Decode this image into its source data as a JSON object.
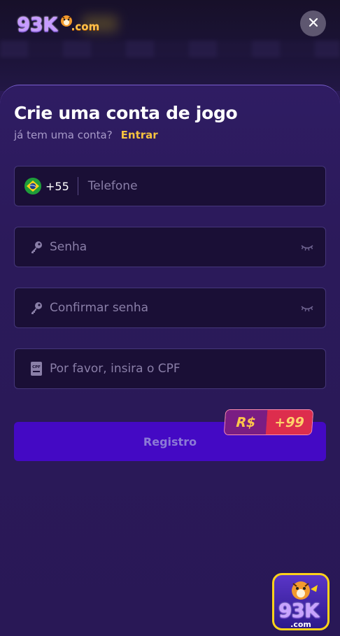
{
  "header": {
    "logo_main": "93K",
    "logo_suffix": ".com",
    "close_icon": "close-icon"
  },
  "form": {
    "title": "Crie uma conta de jogo",
    "subtitle": "já tem uma conta?",
    "login_link": "Entrar",
    "phone": {
      "flag_icon": "brazil-flag-icon",
      "prefix": "+55",
      "placeholder": "Telefone"
    },
    "password": {
      "icon": "key-icon",
      "placeholder": "Senha",
      "toggle_icon": "eye-closed-icon"
    },
    "confirm_password": {
      "icon": "key-icon",
      "placeholder": "Confirmar senha",
      "toggle_icon": "eye-closed-icon"
    },
    "cpf": {
      "icon": "cpf-card-icon",
      "placeholder": "Por favor, insira o CPF"
    },
    "register_label": "Registro",
    "bonus_badge": {
      "currency": "R$",
      "amount": "+99"
    }
  },
  "floating_app": {
    "brand": "93K",
    "suffix": ".com"
  },
  "colors": {
    "background": "#2a1955",
    "accent_link": "#f5c23f",
    "button": "#4409c4",
    "input_bg": "#1a0f36"
  }
}
